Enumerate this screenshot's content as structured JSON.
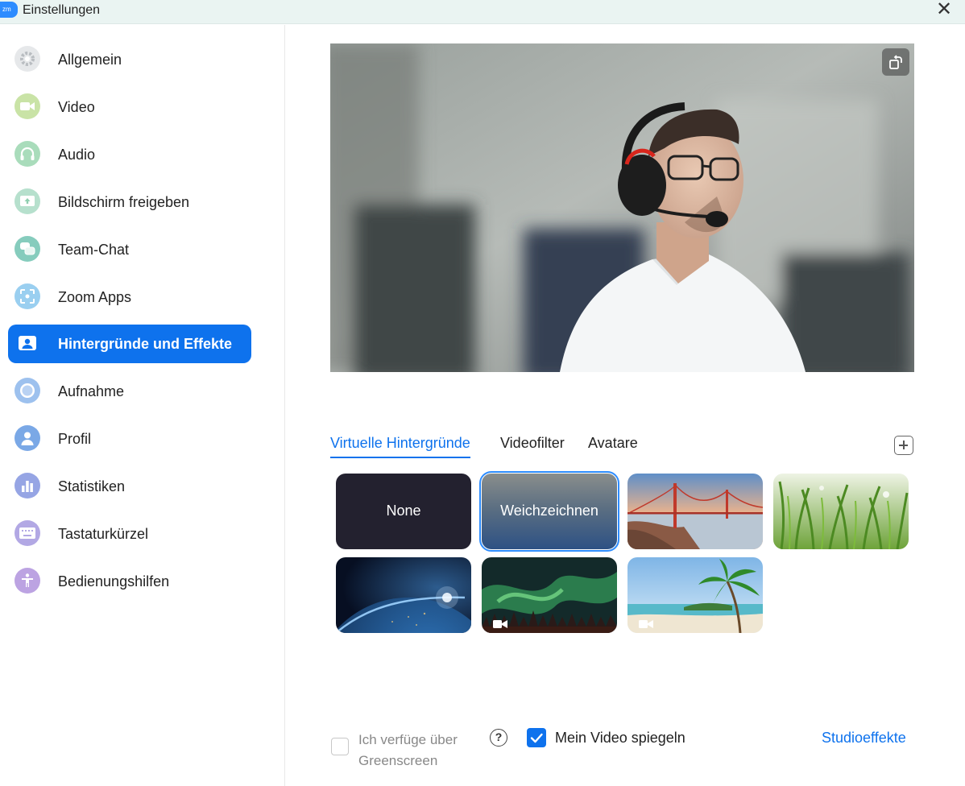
{
  "window": {
    "title": "Einstellungen",
    "logo_text": "zm",
    "close_glyph": "✕"
  },
  "sidebar": {
    "items": [
      {
        "label": "Allgemein",
        "icon": "gear-icon",
        "color": "#d9dcdf"
      },
      {
        "label": "Video",
        "icon": "video-camera-icon",
        "color": "#b9d98f"
      },
      {
        "label": "Audio",
        "icon": "headphones-icon",
        "color": "#9fd8b3"
      },
      {
        "label": "Bildschirm freigeben",
        "icon": "share-screen-icon",
        "color": "#a8dcc4"
      },
      {
        "label": "Team-Chat",
        "icon": "chat-bubbles-icon",
        "color": "#7ec8b8"
      },
      {
        "label": "Zoom Apps",
        "icon": "apps-icon",
        "color": "#8fc8ee"
      },
      {
        "label": "Hintergründe und Effekte",
        "icon": "background-icon",
        "color": "#0e72ed",
        "active": true
      },
      {
        "label": "Aufnahme",
        "icon": "record-icon",
        "color": "#8fb8ea"
      },
      {
        "label": "Profil",
        "icon": "profile-icon",
        "color": "#6a9de0"
      },
      {
        "label": "Statistiken",
        "icon": "statistics-icon",
        "color": "#8a9be0"
      },
      {
        "label": "Tastaturkürzel",
        "icon": "keyboard-icon",
        "color": "#a89ee0"
      },
      {
        "label": "Bedienungshilfen",
        "icon": "accessibility-icon",
        "color": "#b59ade"
      }
    ]
  },
  "tabs": [
    {
      "label": "Virtuelle Hintergründe",
      "active": true
    },
    {
      "label": "Videofilter",
      "active": false
    },
    {
      "label": "Avatare",
      "active": false
    }
  ],
  "backgrounds": [
    {
      "label": "None",
      "kind": "none"
    },
    {
      "label": "Weichzeichnen",
      "kind": "blur",
      "selected": true
    },
    {
      "label": "",
      "kind": "golden-gate-bridge"
    },
    {
      "label": "",
      "kind": "grass"
    },
    {
      "label": "",
      "kind": "earth-from-space"
    },
    {
      "label": "",
      "kind": "aurora",
      "video": true
    },
    {
      "label": "",
      "kind": "beach",
      "video": true
    }
  ],
  "options": {
    "greenscreen_label": "Ich verfüge über Greenscreen",
    "greenscreen_checked": false,
    "help_glyph": "?",
    "mirror_label": "Mein Video spiegeln",
    "mirror_checked": true,
    "studio_link": "Studioeffekte"
  },
  "colors": {
    "accent": "#0e72ed",
    "titlebar": "#eaf4f2"
  }
}
